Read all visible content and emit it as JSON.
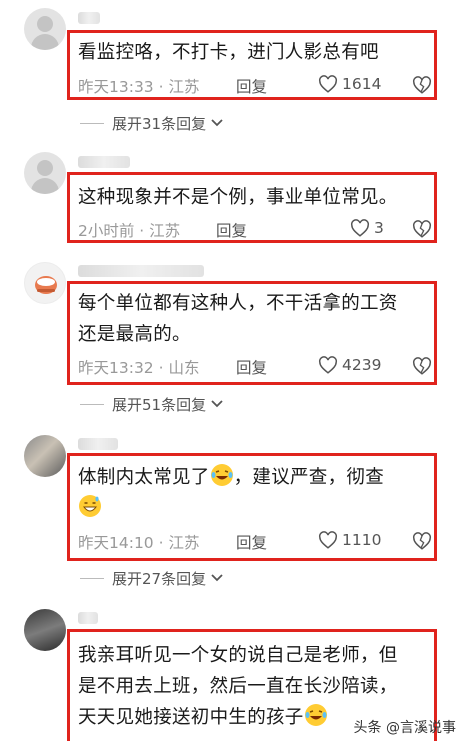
{
  "comments": [
    {
      "text": "看监控咯，不打卡，进门人影总有吧",
      "time": "昨天13:33 · 江苏",
      "reply_label": "回复",
      "likes": "1614",
      "expand": "展开31条回复"
    },
    {
      "text": "这种现象并不是个例，事业单位常见。",
      "time": "2小时前 · 江苏",
      "reply_label": "回复",
      "likes": "3"
    },
    {
      "text_line1": "每个单位都有这种人，不干活拿的工资",
      "text_line2": "还是最高的。",
      "time": "昨天13:32 · 山东",
      "reply_label": "回复",
      "likes": "4239",
      "expand": "展开51条回复"
    },
    {
      "text_part1": "体制内太常见了",
      "text_part2": "，建议严查，彻查",
      "time": "昨天14:10 · 江苏",
      "reply_label": "回复",
      "likes": "1110",
      "expand": "展开27条回复"
    },
    {
      "text_line1": "我亲耳听见一个女的说自己是老师，但",
      "text_line2": "是不用去上班，然后一直在长沙陪读，",
      "text_line3": "天天见她接送初中生的孩子"
    }
  ],
  "watermark": "头条 @言溪说事",
  "colors": {
    "highlight_border": "#e0231d",
    "meta_gray": "#999999"
  }
}
